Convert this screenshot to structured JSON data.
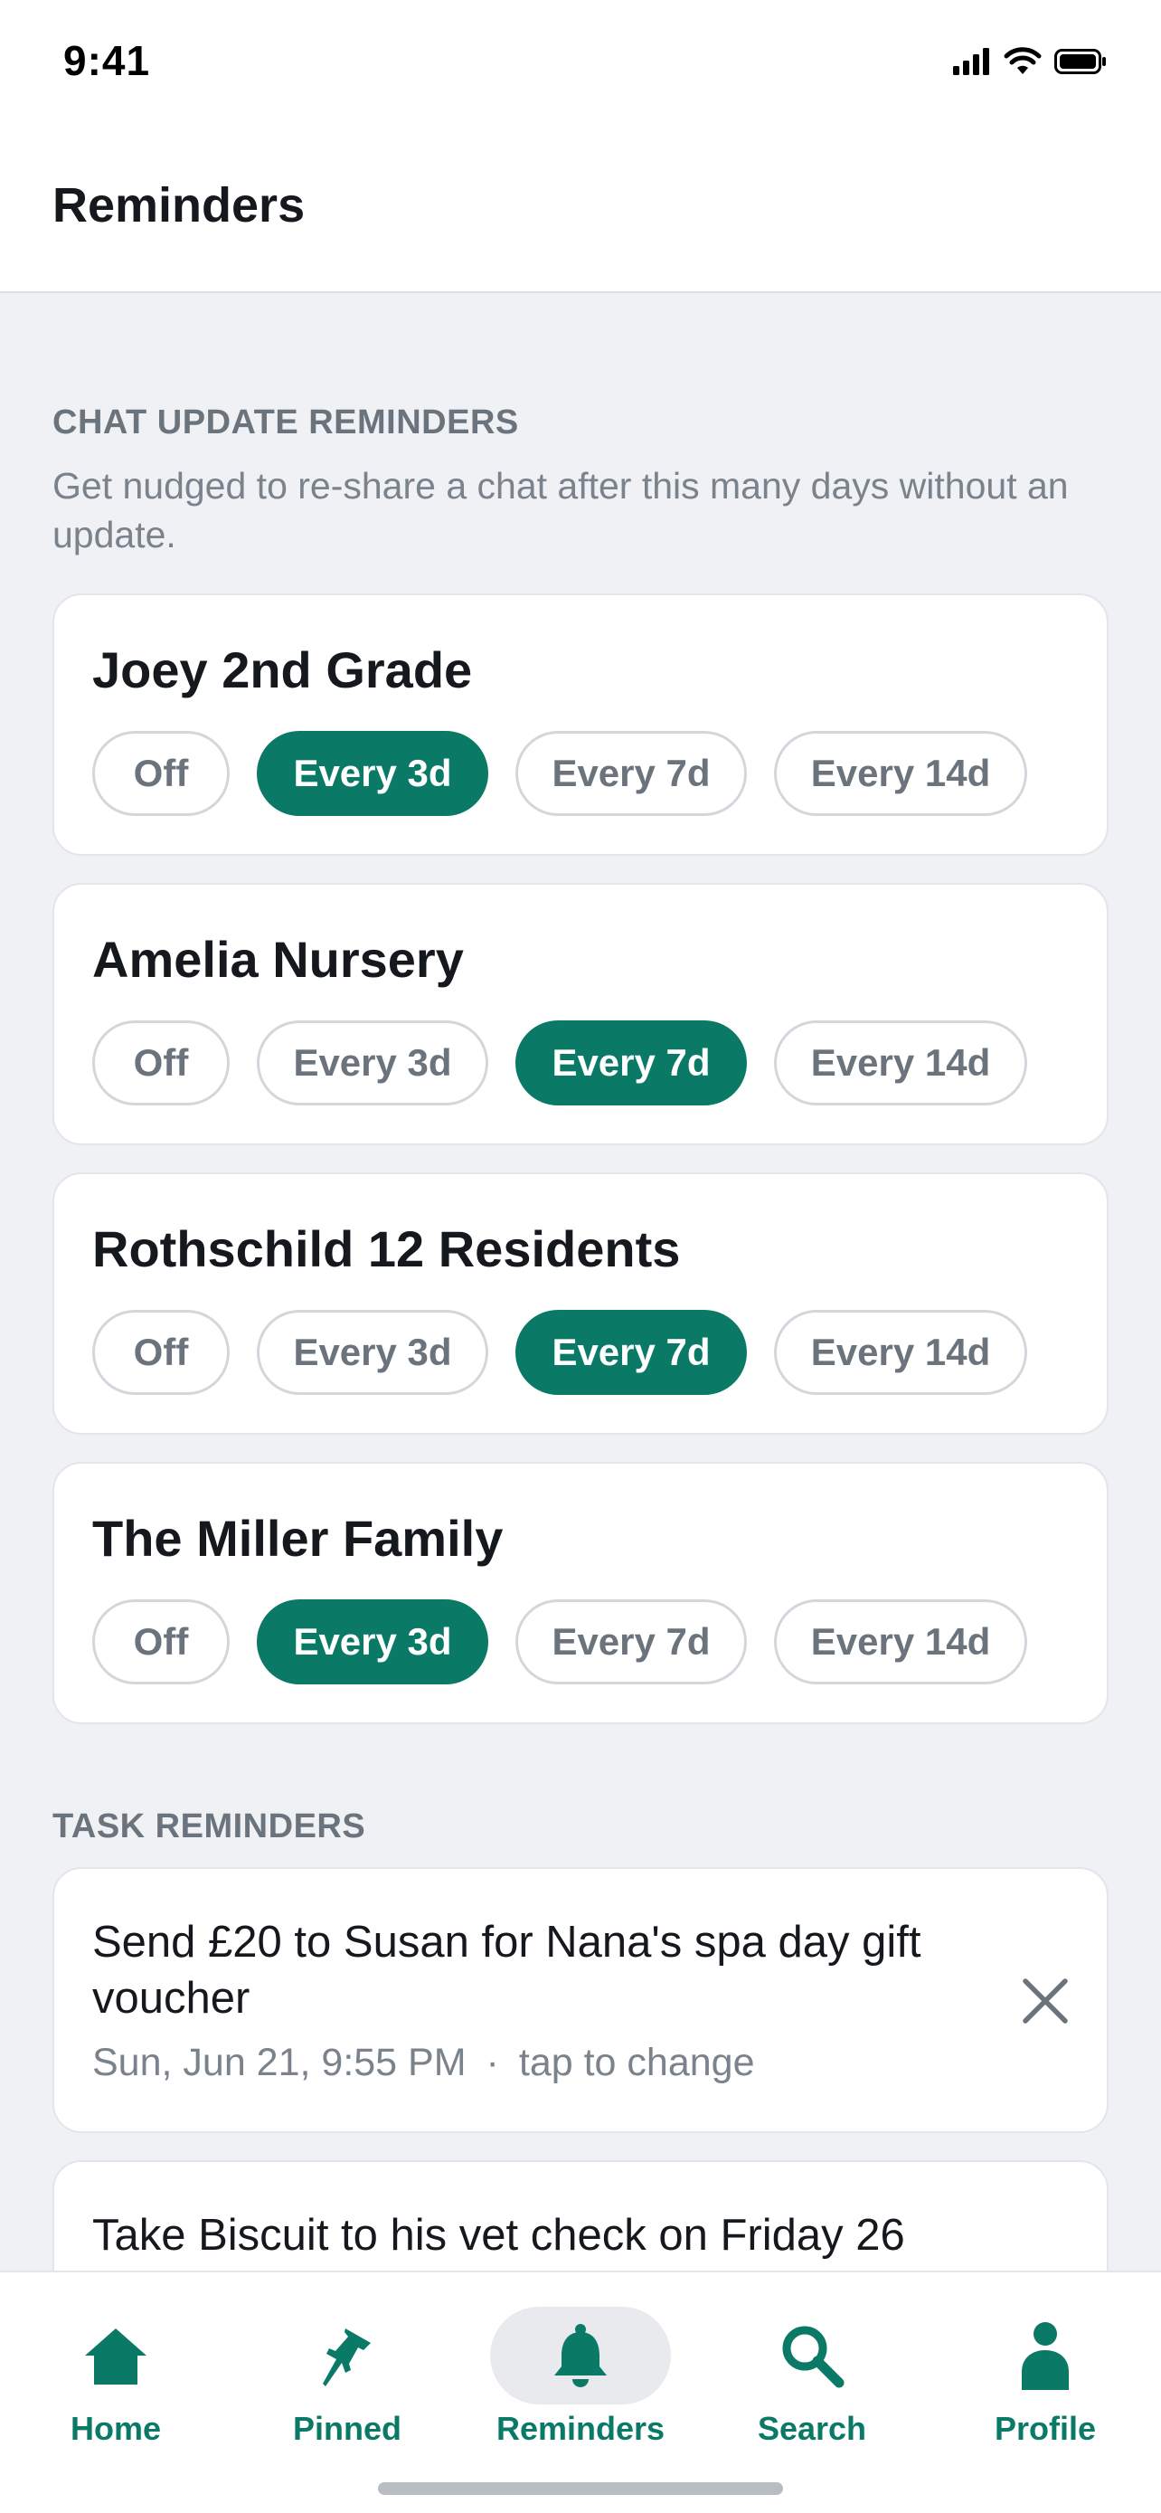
{
  "status_bar": {
    "time": "9:41"
  },
  "header": {
    "title": "Reminders"
  },
  "chat_section": {
    "title": "CHAT UPDATE REMINDERS",
    "description": "Get nudged to re-share a chat after this many days without an update.",
    "options": [
      "Off",
      "Every 3d",
      "Every 7d",
      "Every 14d"
    ],
    "chats": [
      {
        "name": "Joey 2nd Grade",
        "selected": "Every 3d"
      },
      {
        "name": "Amelia Nursery",
        "selected": "Every 7d"
      },
      {
        "name": "Rothschild 12 Residents",
        "selected": "Every 7d"
      },
      {
        "name": "The Miller Family",
        "selected": "Every 3d"
      }
    ]
  },
  "task_section": {
    "title": "TASK REMINDERS",
    "tasks": [
      {
        "title": "Send £20 to Susan for Nana's spa day gift voucher",
        "date": "Sun, Jun 21, 9:55 PM",
        "separator": "·",
        "hint": "tap to change"
      },
      {
        "title": "Take Biscuit to his vet check on Friday 26"
      }
    ]
  },
  "tabs": [
    {
      "label": "Home",
      "icon": "home-icon"
    },
    {
      "label": "Pinned",
      "icon": "pin-icon"
    },
    {
      "label": "Reminders",
      "icon": "bell-icon",
      "active": true
    },
    {
      "label": "Search",
      "icon": "search-icon"
    },
    {
      "label": "Profile",
      "icon": "profile-icon"
    }
  ],
  "colors": {
    "accent": "#0a7a66",
    "background": "#eff1f5",
    "card": "#ffffff"
  }
}
